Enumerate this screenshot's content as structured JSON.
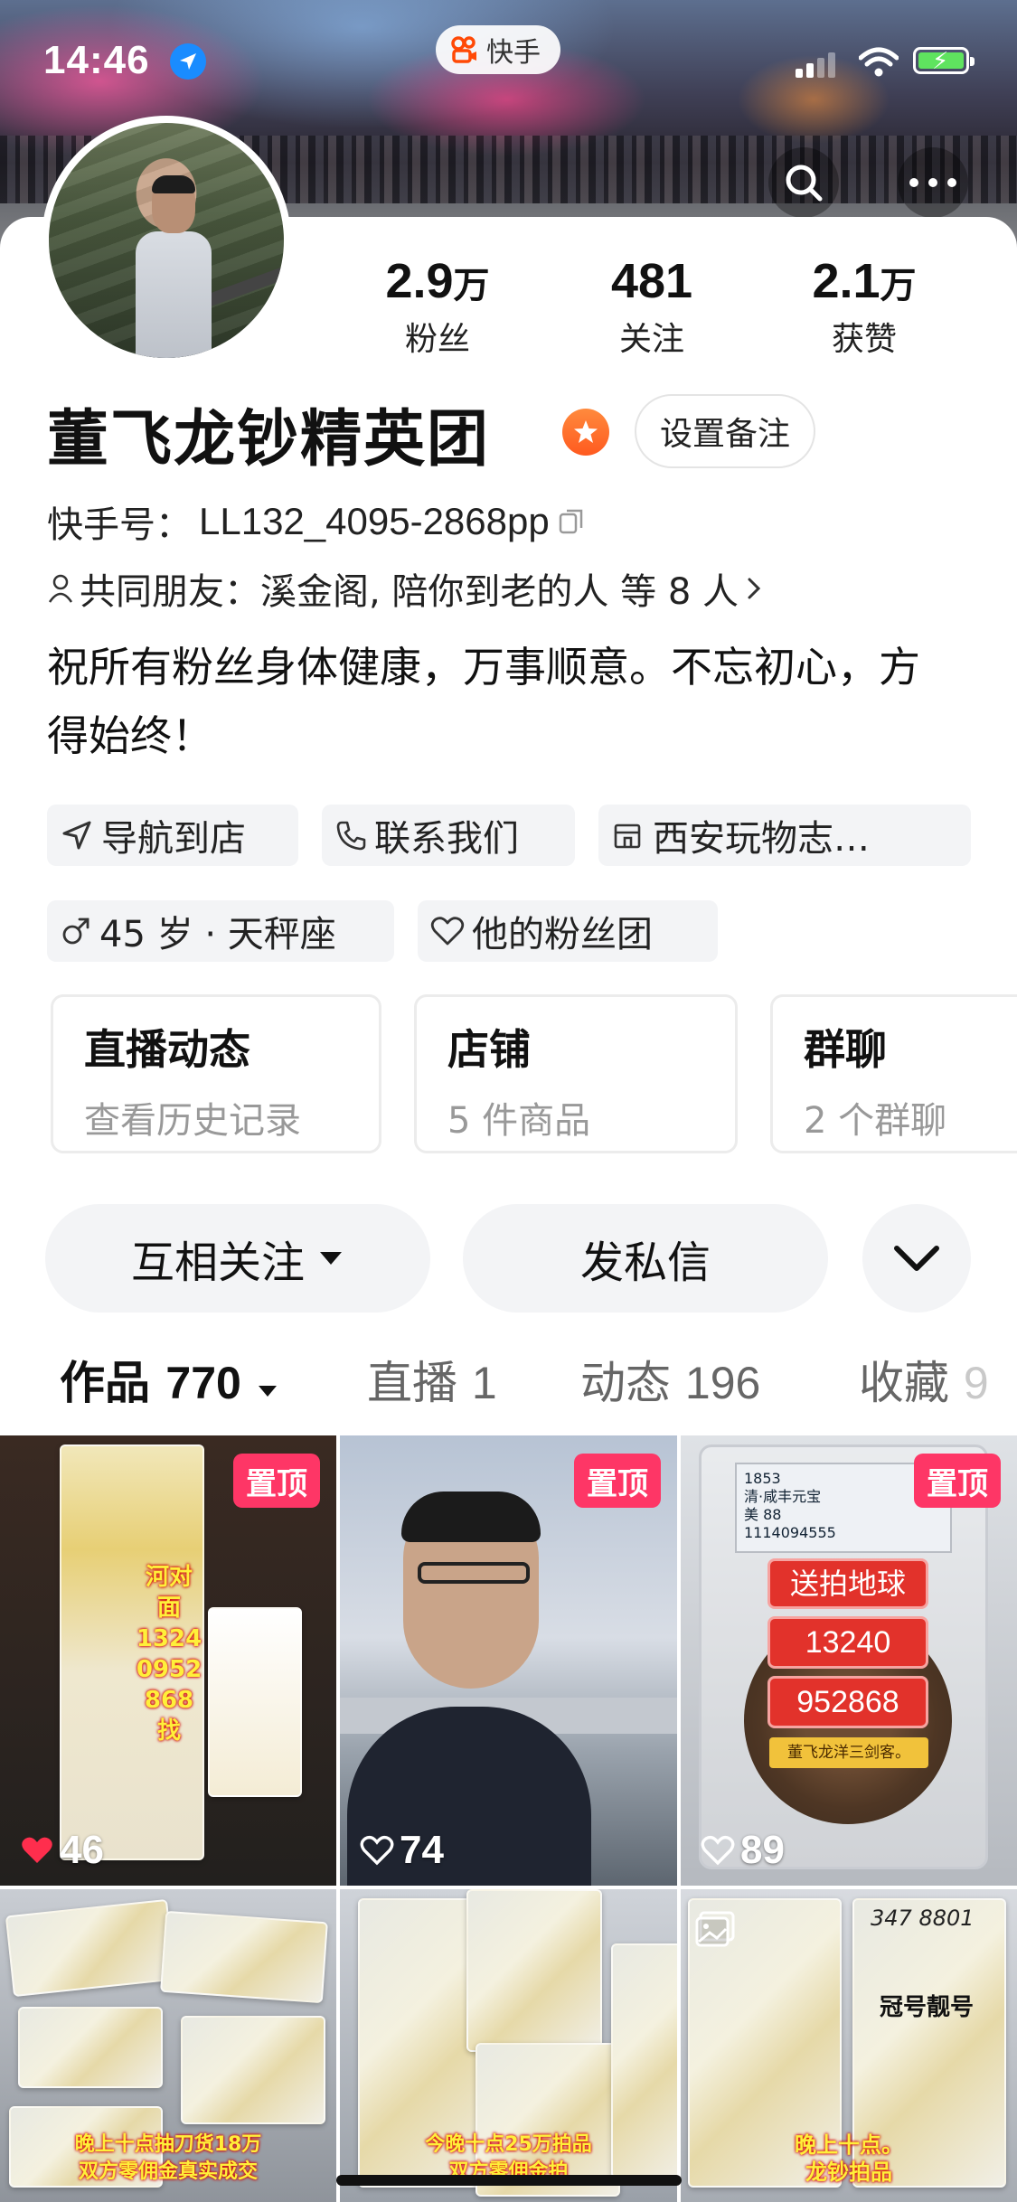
{
  "status_bar": {
    "time": "14:46",
    "app_pill": "快手"
  },
  "profile": {
    "stats": [
      {
        "value": "2.9",
        "unit": "万",
        "label": "粉丝"
      },
      {
        "value": "481",
        "unit": "",
        "label": "关注"
      },
      {
        "value": "2.1",
        "unit": "万",
        "label": "获赞"
      }
    ],
    "name": "董飞龙钞精英团",
    "remark_button": "设置备注",
    "kuaishou_id_label": "快手号：",
    "kuaishou_id": "LL132_4095-2868pp",
    "mutual_friends": "共同朋友：溪金阁, 陪你到老的人 等 8 人",
    "bio": "祝所有粉丝身体健康，万事顺意。不忘初心，方得始终！",
    "chips_row1": [
      {
        "label": "导航到店",
        "icon": "navigation-icon"
      },
      {
        "label": "联系我们",
        "icon": "phone-icon"
      },
      {
        "label": "西安玩物志…",
        "icon": "store-icon"
      }
    ],
    "chips_row2": [
      {
        "label": "45 岁 · 天秤座",
        "icon": "male-icon"
      },
      {
        "label": "他的粉丝团",
        "icon": "heart-outline-icon"
      }
    ],
    "cards": [
      {
        "title": "直播动态",
        "sub": "查看历史记录"
      },
      {
        "title": "店铺",
        "sub": "5 件商品"
      },
      {
        "title": "群聊",
        "sub": "2 个群聊"
      }
    ],
    "follow_button": "互相关注",
    "message_button": "发私信"
  },
  "tabs": [
    {
      "label": "作品",
      "count": "770",
      "active": true
    },
    {
      "label": "直播",
      "count": "1",
      "active": false
    },
    {
      "label": "动态",
      "count": "196",
      "active": false
    },
    {
      "label": "收藏",
      "count": "9",
      "active": false
    }
  ],
  "grid": [
    {
      "pinned": "置顶",
      "likes": "46",
      "liked": true,
      "overlay": [
        "河对面",
        "1324",
        "0952",
        "868",
        "找"
      ]
    },
    {
      "pinned": "置顶",
      "likes": "74",
      "liked": false
    },
    {
      "pinned": "置顶",
      "likes": "89",
      "liked": false,
      "slab_header": [
        "1853",
        "清·咸丰元宝",
        "美 88",
        "1114094555"
      ],
      "overlay": [
        "送拍地球",
        "13240",
        "952868",
        "董飞龙洋三剑客。"
      ]
    },
    {
      "caption": [
        "晚上十点抽刀货18万",
        "双方零佣金真实成交"
      ]
    },
    {
      "caption": [
        "今晚十点25万拍品",
        "双方零佣金拍"
      ]
    },
    {
      "caption": [
        "晚上十点。",
        "龙钞拍品"
      ],
      "handwriting": "冠号靓号",
      "note_serial": "347 8801"
    }
  ],
  "colors": {
    "accent_red": "#fe3666",
    "badge_orange": "#ff6a2a",
    "chip_bg": "#f3f4f6"
  }
}
